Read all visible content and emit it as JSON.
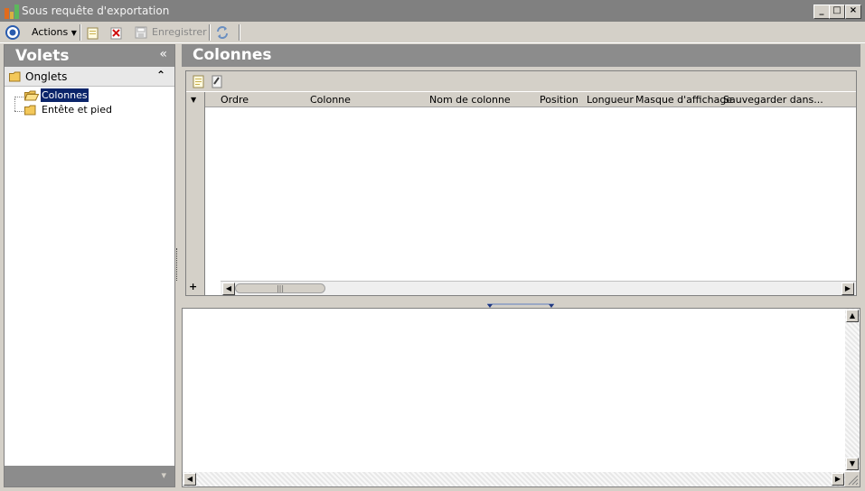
{
  "window": {
    "title": "Sous requête d'exportation",
    "controls": {
      "minimize": "_",
      "maximize": "□",
      "close": "×"
    }
  },
  "toolbar": {
    "actions_label": "Actions",
    "save_label": "Enregistrer"
  },
  "left_pane": {
    "header": "Volets",
    "collapse_glyph": "«",
    "section": "Onglets",
    "section_toggle_glyph": "⌃",
    "tree": [
      {
        "label": "Colonnes",
        "selected": true
      },
      {
        "label": "Entête et pied",
        "selected": false
      }
    ],
    "bottom_glyph": "▾"
  },
  "main": {
    "header": "Colonnes",
    "grid": {
      "columns": [
        "Ordre",
        "Colonne",
        "Nom de colonne",
        "Position",
        "Longueur",
        "Masque d'affichage",
        "Sauvegarder dans..."
      ],
      "add_glyph": "+",
      "rows": []
    }
  },
  "colors": {
    "chrome": "#d4d0c8",
    "header_bg": "#8c8c8c",
    "selection": "#0a246a"
  }
}
